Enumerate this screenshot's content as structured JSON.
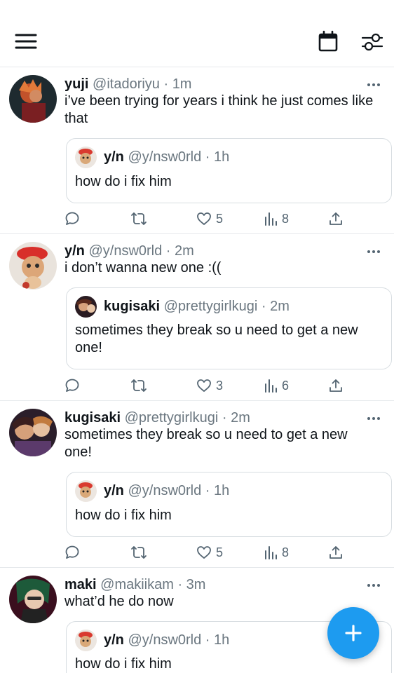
{
  "topbar": {
    "menu_icon": "menu-icon",
    "calendar_icon": "calendar-icon",
    "filter_icon": "filter-icon"
  },
  "tweets": [
    {
      "name": "yuji",
      "handle": "@itadoriyu · 1m",
      "text": "i’ve been trying for years i think he just comes like that",
      "quote": {
        "name": "y/n",
        "handle": "@y/nsw0rld · 1h",
        "text": "how do i fix him"
      },
      "likes": "5",
      "views": "8"
    },
    {
      "name": "y/n",
      "handle": "@y/nsw0rld · 2m",
      "text": "i don’t wanna new one :((",
      "quote": {
        "name": "kugisaki",
        "handle": "@prettygirlkugi · 2m",
        "text": "sometimes they break so u need to get a new one!"
      },
      "likes": "3",
      "views": "6"
    },
    {
      "name": "kugisaki",
      "handle": "@prettygirlkugi · 2m",
      "text": "sometimes they break so u need to get a new one!",
      "quote": {
        "name": "y/n",
        "handle": "@y/nsw0rld · 1h",
        "text": "how do i fix him"
      },
      "likes": "5",
      "views": "8"
    },
    {
      "name": "maki",
      "handle": "@makiikam · 3m",
      "text": "what’d he do now",
      "quote": {
        "name": "y/n",
        "handle": "@y/nsw0rld · 1h",
        "text": "how do i fix him"
      }
    }
  ],
  "colors": {
    "accent": "#1d9bf0",
    "muted": "#536471",
    "divider": "#e6e9ec"
  }
}
